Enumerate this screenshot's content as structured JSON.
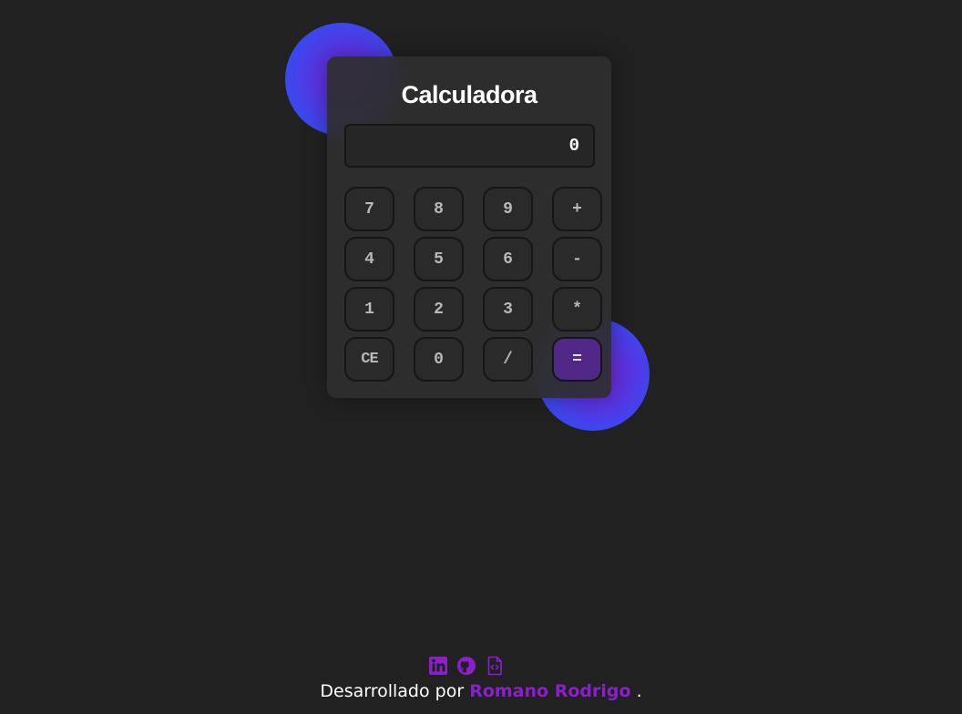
{
  "calculator": {
    "title": "Calculadora",
    "display_value": "0",
    "keys": [
      [
        "7",
        "8",
        "9",
        "+"
      ],
      [
        "4",
        "5",
        "6",
        "-"
      ],
      [
        "1",
        "2",
        "3",
        "*"
      ],
      [
        "CE",
        "0",
        "/",
        "="
      ]
    ]
  },
  "footer": {
    "icons": [
      "linkedin-icon",
      "github-icon",
      "code-file-icon"
    ],
    "prefix": "Desarrollado por",
    "author": "Romano Rodrigo",
    "suffix": "."
  },
  "colors": {
    "background": "#212121",
    "card": "#2e2e2e",
    "accent": "#8b1fce",
    "blob_blue": "#3550f0",
    "blob_purple": "#7d24d6"
  }
}
